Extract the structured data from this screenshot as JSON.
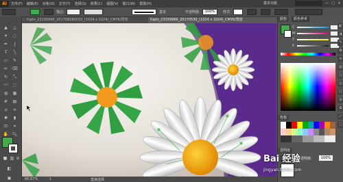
{
  "app": {
    "logo": "Ai",
    "workspace": "基本功能"
  },
  "menu": [
    "文件(F)",
    "编辑(E)",
    "对象(O)",
    "文字(T)",
    "选择(S)",
    "效果(C)",
    "视图(V)",
    "窗口(W)",
    "帮助(H)"
  ],
  "window_controls": [
    "—",
    "□",
    "✕"
  ],
  "control_bar": {
    "label1": "描边:",
    "style_label": "基本",
    "opacity_label": "不透明度:",
    "opacity_value": "100%",
    "style2": "样式:"
  },
  "tabs": [
    {
      "label": "fupin_23199996_201708160032_(1024 x 1024)_CMYK/预览"
    },
    {
      "label": "fupin_23159966_20170530_(1024 x 1024)_CMYK/预览"
    }
  ],
  "panel": {
    "color_tab": "颜色",
    "guide_tab": "颜色参考",
    "sliders": [
      {
        "label": "C",
        "value": "",
        "color": "#00a0e8"
      },
      {
        "label": "M",
        "value": "",
        "color": "#e4007f"
      },
      {
        "label": "Y",
        "value": "",
        "color": "#fff100"
      },
      {
        "label": "K",
        "value": "",
        "color": "#231815"
      }
    ],
    "swatches_tab": "色板",
    "transparency_tab": "透明度",
    "transparency_mode": "正常",
    "transparency_opacity_label": "不透明度:",
    "transparency_opacity": "100%"
  },
  "status": {
    "zoom": "66.67%",
    "page": "1",
    "tool": "直接选择"
  },
  "colors": {
    "fill": "#3fae49",
    "accent": "#ff9a00",
    "petal_green": "#2f9e3f",
    "center_orange": "#f39a1e",
    "purple_bg": "#5a2a8c"
  },
  "watermark": {
    "text": "Bai 经验",
    "url": "jingyan.baidu.com"
  }
}
